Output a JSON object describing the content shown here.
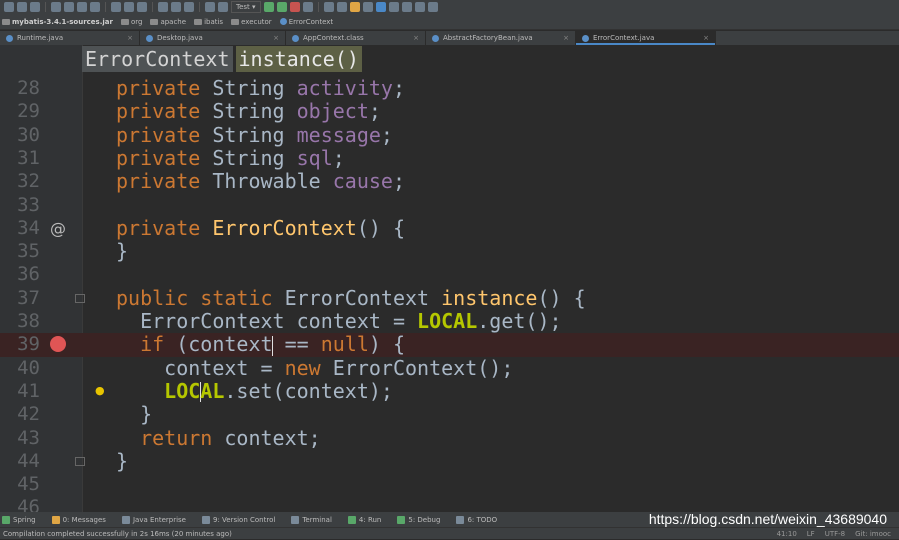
{
  "toolbar": {
    "run_config": "Test"
  },
  "breadcrumb": [
    {
      "label": "mybatis-3.4.1-sources.jar",
      "icon": "archive-icon"
    },
    {
      "label": "org",
      "icon": "folder-icon"
    },
    {
      "label": "apache",
      "icon": "folder-icon"
    },
    {
      "label": "ibatis",
      "icon": "folder-icon"
    },
    {
      "label": "executor",
      "icon": "folder-icon"
    },
    {
      "label": "ErrorContext",
      "icon": "class-icon"
    }
  ],
  "tabs": [
    {
      "label": "Runtime.java"
    },
    {
      "label": "Desktop.java"
    },
    {
      "label": "AppContext.class"
    },
    {
      "label": "AbstractFactoryBean.java"
    },
    {
      "label": "ErrorContext.java"
    }
  ],
  "nav": {
    "class_name": "ErrorContext",
    "method_name": "instance()"
  },
  "code_lines": [
    {
      "n": "28",
      "parts": [
        [
          "kw",
          "private "
        ],
        [
          "",
          "String "
        ],
        [
          "fld",
          "activity"
        ],
        [
          "",
          ";"
        ]
      ]
    },
    {
      "n": "29",
      "parts": [
        [
          "kw",
          "private "
        ],
        [
          "",
          "String "
        ],
        [
          "fld",
          "object"
        ],
        [
          "",
          ";"
        ]
      ]
    },
    {
      "n": "30",
      "parts": [
        [
          "kw",
          "private "
        ],
        [
          "",
          "String "
        ],
        [
          "fld",
          "message"
        ],
        [
          "",
          ";"
        ]
      ]
    },
    {
      "n": "31",
      "parts": [
        [
          "kw",
          "private "
        ],
        [
          "",
          "String "
        ],
        [
          "fld",
          "sql"
        ],
        [
          "",
          ";"
        ]
      ]
    },
    {
      "n": "32",
      "parts": [
        [
          "kw",
          "private "
        ],
        [
          "",
          "Throwable "
        ],
        [
          "fld",
          "cause"
        ],
        [
          "",
          ";"
        ]
      ]
    },
    {
      "n": "33",
      "parts": []
    },
    {
      "n": "34",
      "parts": [
        [
          "kw",
          "private "
        ],
        [
          "mth",
          "ErrorContext"
        ],
        [
          "",
          "() {"
        ]
      ],
      "marker": "@"
    },
    {
      "n": "35",
      "parts": [
        [
          "",
          "}"
        ]
      ]
    },
    {
      "n": "36",
      "parts": []
    },
    {
      "n": "37",
      "parts": [
        [
          "kw",
          "public static "
        ],
        [
          "",
          "ErrorContext "
        ],
        [
          "mth",
          "instance"
        ],
        [
          "",
          "() {"
        ]
      ],
      "fold": true
    },
    {
      "n": "38",
      "parts": [
        [
          "",
          "  ErrorContext context = "
        ],
        [
          "lcl",
          "LOCAL"
        ],
        [
          "",
          ".get();"
        ]
      ]
    },
    {
      "n": "39",
      "parts": [
        [
          "",
          "  "
        ],
        [
          "kw",
          "if "
        ],
        [
          "",
          "(context"
        ],
        [
          "caret",
          ""
        ],
        [
          "lcl",
          ""
        ],
        [
          "",
          " == "
        ],
        [
          "kw",
          "null"
        ],
        [
          "",
          ") {"
        ]
      ],
      "breakpoint": true
    },
    {
      "n": "40",
      "parts": [
        [
          "",
          "    context = "
        ],
        [
          "kw",
          "new "
        ],
        [
          "",
          "ErrorContext();"
        ]
      ]
    },
    {
      "n": "41",
      "parts": [
        [
          "",
          "    "
        ],
        [
          "lcl",
          "LOC"
        ],
        [
          "caret",
          ""
        ],
        [
          "lcl",
          "AL"
        ],
        [
          "",
          ".set(context);"
        ]
      ],
      "bulb": true
    },
    {
      "n": "42",
      "parts": [
        [
          "",
          "  }"
        ]
      ]
    },
    {
      "n": "43",
      "parts": [
        [
          "",
          "  "
        ],
        [
          "kw",
          "return "
        ],
        [
          "",
          "context;"
        ]
      ]
    },
    {
      "n": "44",
      "parts": [
        [
          "",
          "}"
        ]
      ],
      "fold": true
    },
    {
      "n": "45",
      "parts": []
    },
    {
      "n": "46",
      "parts": []
    }
  ],
  "tool_windows": [
    {
      "label": "Spring",
      "icon": "spring-icon"
    },
    {
      "label": "0: Messages",
      "icon": "messages-icon"
    },
    {
      "label": "Java Enterprise",
      "icon": "java-enterprise-icon"
    },
    {
      "label": "9: Version Control",
      "icon": "version-control-icon"
    },
    {
      "label": "Terminal",
      "icon": "terminal-icon"
    },
    {
      "label": "4: Run",
      "icon": "run-icon"
    },
    {
      "label": "5: Debug",
      "icon": "debug-icon"
    },
    {
      "label": "6: TODO",
      "icon": "todo-icon"
    }
  ],
  "watermark": "https://blog.csdn.net/weixin_43689040",
  "status": {
    "message": "Compilation completed successfully in 2s 16ms (20 minutes ago)",
    "position": "41:10",
    "line_sep": "LF",
    "encoding": "UTF-8",
    "vcs": "Git: imooc"
  }
}
